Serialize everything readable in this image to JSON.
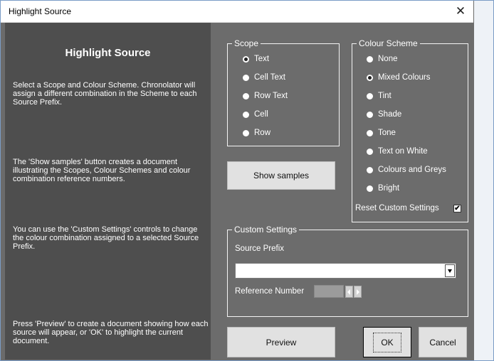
{
  "window": {
    "title": "Highlight Source",
    "close_glyph": "✕"
  },
  "left_panel": {
    "heading": "Highlight Source",
    "para1": "Select a Scope and Colour Scheme. Chronolator will assign a different combination in the Scheme to each Source Prefix.",
    "para2": "The 'Show samples' button creates a document illustrating the Scopes, Colour Schemes and colour combination reference numbers.",
    "para3": "You can use the 'Custom Settings' controls to change the colour combination assigned to a selected Source Prefix.",
    "para4": "Press 'Preview' to create a document showing how each source will appear, or 'OK' to highlight the current document."
  },
  "scope": {
    "legend": "Scope",
    "options": [
      "Text",
      "Cell Text",
      "Row Text",
      "Cell",
      "Row"
    ],
    "selected": "Text"
  },
  "colour_scheme": {
    "legend": "Colour Scheme",
    "options": [
      "None",
      "Mixed Colours",
      "Tint",
      "Shade",
      "Tone",
      "Text on White",
      "Colours and Greys",
      "Bright"
    ],
    "selected": "Mixed Colours",
    "reset_label": "Reset Custom Settings",
    "reset_checked": true,
    "check_glyph": "✔"
  },
  "show_samples_label": "Show samples",
  "custom_settings": {
    "legend": "Custom Settings",
    "source_prefix_label": "Source Prefix",
    "source_prefix_value": "",
    "reference_number_label": "Reference Number",
    "reference_number_value": ""
  },
  "buttons": {
    "preview": "Preview",
    "ok": "OK",
    "cancel": "Cancel"
  },
  "icons": [
    "close-icon",
    "radio-icon",
    "check-icon",
    "dropdown-arrow-icon",
    "spin-left-icon",
    "spin-right-icon"
  ]
}
